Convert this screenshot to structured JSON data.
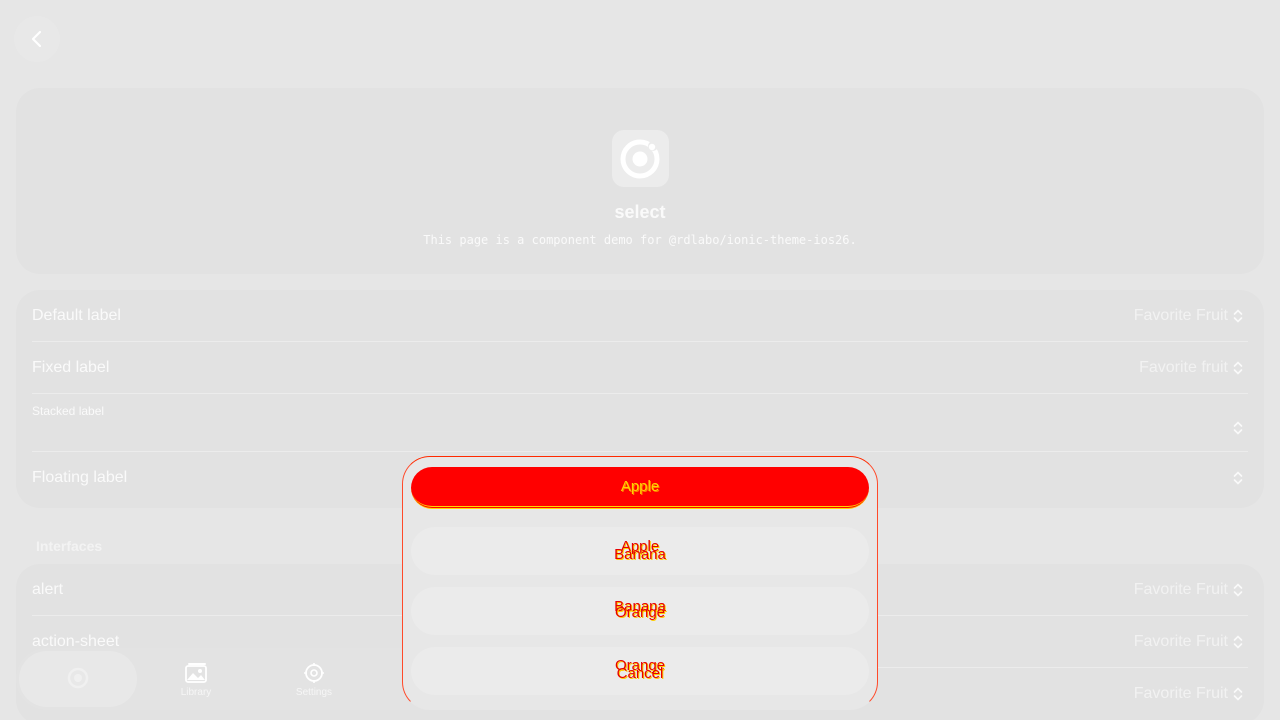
{
  "nav": {
    "back_icon": "chevron-left-icon"
  },
  "hero": {
    "logo_icon": "ionic-logo-icon",
    "title": "select",
    "description": "This page is a component demo for @rdlabo/ionic-theme-ios26."
  },
  "labels_list": {
    "rows": [
      {
        "label": "Default label",
        "value": "Favorite Fruit"
      },
      {
        "label": "Fixed label",
        "value": "Favorite fruit"
      },
      {
        "label": "Stacked label",
        "value": ""
      },
      {
        "label": "Floating label",
        "value": ""
      }
    ]
  },
  "interfaces": {
    "header": "Interfaces",
    "rows": [
      {
        "label": "alert",
        "value": "Favorite Fruit"
      },
      {
        "label": "action-sheet",
        "value": "Favorite Fruit"
      },
      {
        "label": "",
        "value": "Favorite Fruit"
      }
    ]
  },
  "tabbar": {
    "tabs": [
      {
        "label": "",
        "icon": "ionic-logo-icon",
        "active": true
      },
      {
        "label": "Library",
        "icon": "images-icon",
        "active": false
      },
      {
        "label": "Settings",
        "icon": "gear-icon",
        "active": false
      },
      {
        "label": "",
        "icon": "search-icon",
        "active": false
      }
    ]
  },
  "popover": {
    "options": [
      {
        "label": "Apple",
        "ghost": "",
        "selected": true
      },
      {
        "label": "Apple",
        "ghost": "Banana",
        "selected": false
      },
      {
        "label": "Banana",
        "ghost": "Orange",
        "selected": false
      },
      {
        "label": "Orange",
        "ghost": "Cancel",
        "selected": false
      }
    ]
  },
  "colors": {
    "background": "#e6e6e6",
    "card": "#e2e2e2",
    "accent_red": "#ff0000",
    "accent_yellow": "#ffd400"
  }
}
